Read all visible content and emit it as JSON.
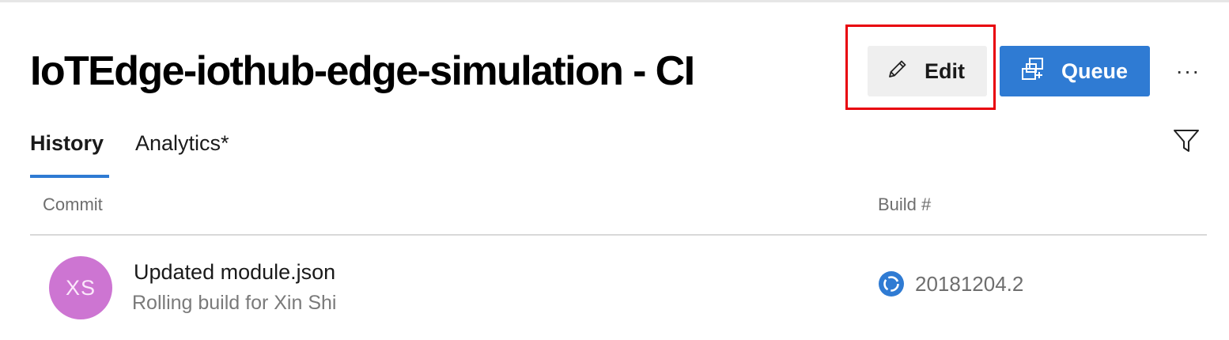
{
  "header": {
    "title": "IoTEdge-iothub-edge-simulation - CI",
    "edit_label": "Edit",
    "queue_label": "Queue",
    "more_label": "···"
  },
  "tabs": [
    {
      "label": "History",
      "selected": true
    },
    {
      "label": "Analytics*",
      "selected": false
    }
  ],
  "table": {
    "columns": [
      "Commit",
      "Build #"
    ],
    "rows": [
      {
        "avatar_initials": "XS",
        "avatar_color": "#cd75d2",
        "commit_message": "Updated module.json",
        "subtitle": "Rolling build for Xin Shi",
        "status_icon": "in-progress-icon",
        "build_number": "20181204.2"
      }
    ]
  },
  "icons": {
    "edit": "pencil-icon",
    "queue": "queue-icon",
    "more": "more-icon",
    "filter": "filter-icon"
  },
  "colors": {
    "accent": "#2f7bd3",
    "highlight": "#e8000b",
    "edit_button_bg": "#efefef"
  }
}
